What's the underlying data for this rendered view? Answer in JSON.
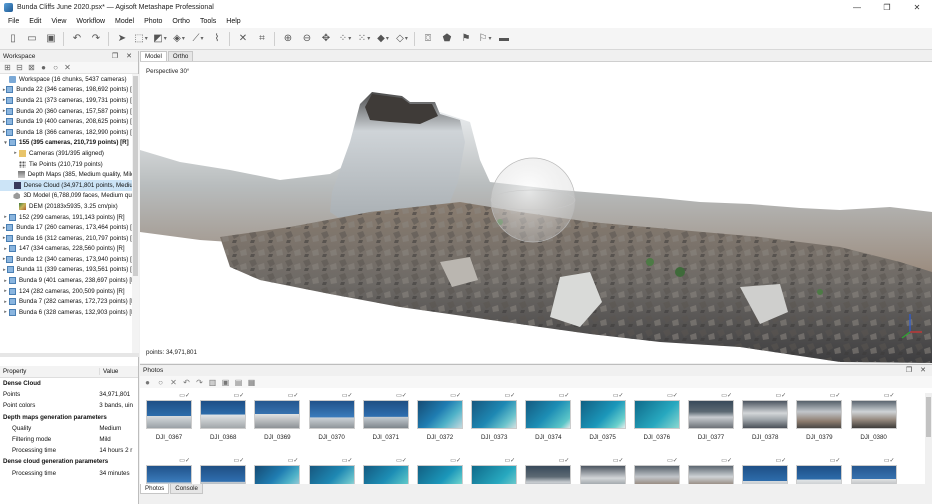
{
  "window": {
    "title": "Bunda Cliffs June 2020.psx* — Agisoft Metashape Professional",
    "controls": [
      "—",
      "❐",
      "✕"
    ]
  },
  "menu": [
    "File",
    "Edit",
    "View",
    "Workflow",
    "Model",
    "Photo",
    "Ortho",
    "Tools",
    "Help"
  ],
  "workspace": {
    "title": "Workspace",
    "controls": "❐ ✕",
    "rows": [
      {
        "text": "Workspace (16 chunks, 5437 cameras)",
        "icon": "workspace-icon",
        "level": 0,
        "expand": ""
      },
      {
        "text": "Bunda 22 (346 cameras, 198,692 points) [R]",
        "icon": "chunk-icon",
        "level": 0,
        "expand": "▸"
      },
      {
        "text": "Bunda 21 (373 cameras, 199,731 points) [R]",
        "icon": "chunk-icon",
        "level": 0,
        "expand": "▸"
      },
      {
        "text": "Bunda 20 (360 cameras, 157,587 points) [R]",
        "icon": "chunk-icon",
        "level": 0,
        "expand": "▸"
      },
      {
        "text": "Bunda 19 (400 cameras, 208,625 points) [R]",
        "icon": "chunk-icon",
        "level": 0,
        "expand": "▸"
      },
      {
        "text": "Bunda 18 (366 cameras, 182,990 points) [R]",
        "icon": "chunk-icon",
        "level": 0,
        "expand": "▸"
      },
      {
        "text": "155 (395 cameras, 210,719 points) [R]",
        "icon": "chunk-icon",
        "level": 0,
        "expand": "▾",
        "bold": true
      },
      {
        "text": "Cameras (391/395 aligned)",
        "icon": "folder-icon",
        "level": 1,
        "expand": "▸"
      },
      {
        "text": "Tie Points (210,719 points)",
        "icon": "tie-points-icon",
        "level": 1,
        "expand": ""
      },
      {
        "text": "Depth Maps (385, Medium quality, Mild f",
        "icon": "depth-maps-icon",
        "level": 1,
        "expand": ""
      },
      {
        "text": "Dense Cloud (34,971,801 points, Medium",
        "icon": "dense-cloud-icon",
        "level": 1,
        "expand": "",
        "selected": true
      },
      {
        "text": "3D Model (6,788,099 faces, Medium quali",
        "icon": "model-icon",
        "level": 1,
        "expand": ""
      },
      {
        "text": "DEM (20183x5935, 3.25 cm/pix)",
        "icon": "dem-icon",
        "level": 1,
        "expand": ""
      },
      {
        "text": "152 (299 cameras, 191,143 points) [R]",
        "icon": "chunk-icon",
        "level": 0,
        "expand": "▸"
      },
      {
        "text": "Bunda 17 (260 cameras, 173,464 points) [R]",
        "icon": "chunk-icon",
        "level": 0,
        "expand": "▸"
      },
      {
        "text": "Bunda 16 (312 cameras, 210,797 points) [R]",
        "icon": "chunk-icon",
        "level": 0,
        "expand": "▸"
      },
      {
        "text": "147 (334 cameras, 228,560 points) [R]",
        "icon": "chunk-icon",
        "level": 0,
        "expand": "▸"
      },
      {
        "text": "Bunda 12 (340 cameras, 173,940 points) [R]",
        "icon": "chunk-icon",
        "level": 0,
        "expand": "▸"
      },
      {
        "text": "Bunda 11 (339 cameras, 193,561 points) [R]",
        "icon": "chunk-icon",
        "level": 0,
        "expand": "▸"
      },
      {
        "text": "Bunda 9 (401 cameras, 238,697 points) [R]",
        "icon": "chunk-icon",
        "level": 0,
        "expand": "▸"
      },
      {
        "text": "124 (282 cameras, 200,509 points) [R]",
        "icon": "chunk-icon",
        "level": 0,
        "expand": "▸"
      },
      {
        "text": "Bunda 7 (282 cameras, 172,723 points) [R]",
        "icon": "chunk-icon",
        "level": 0,
        "expand": "▸"
      },
      {
        "text": "Bunda 6 (328 cameras, 132,903 points) [R]",
        "icon": "chunk-icon",
        "level": 0,
        "expand": "▸"
      }
    ]
  },
  "properties": {
    "col_property": "Property",
    "col_value": "Value",
    "rows": [
      {
        "key": "Dense Cloud",
        "value": "",
        "type": "group"
      },
      {
        "key": "Points",
        "value": "34,971,801",
        "type": "row"
      },
      {
        "key": "Point colors",
        "value": "3 bands, uin",
        "type": "row"
      },
      {
        "key": "Depth maps generation parameters",
        "value": "",
        "type": "group"
      },
      {
        "key": "Quality",
        "value": "Medium",
        "type": "indent"
      },
      {
        "key": "Filtering mode",
        "value": "Mild",
        "type": "indent"
      },
      {
        "key": "Processing time",
        "value": "14 hours 2 r",
        "type": "indent"
      },
      {
        "key": "Dense cloud generation parameters",
        "value": "",
        "type": "group"
      },
      {
        "key": "Processing time",
        "value": "34 minutes",
        "type": "indent"
      }
    ]
  },
  "view": {
    "tabs": [
      "Model",
      "Ortho"
    ],
    "perspective": "Perspective 30°",
    "points_label": "points: 34,971,801"
  },
  "photos": {
    "title": "Photos",
    "controls": "❐ ✕",
    "row1": [
      "DJI_0367",
      "DJI_0368",
      "DJI_0369",
      "DJI_0370",
      "DJI_0371",
      "DJI_0372",
      "DJI_0373",
      "DJI_0374",
      "DJI_0375",
      "DJI_0376",
      "DJI_0377",
      "DJI_0378",
      "DJI_0379",
      "DJI_0380"
    ],
    "bottom_tabs": [
      "Photos",
      "Console"
    ]
  }
}
